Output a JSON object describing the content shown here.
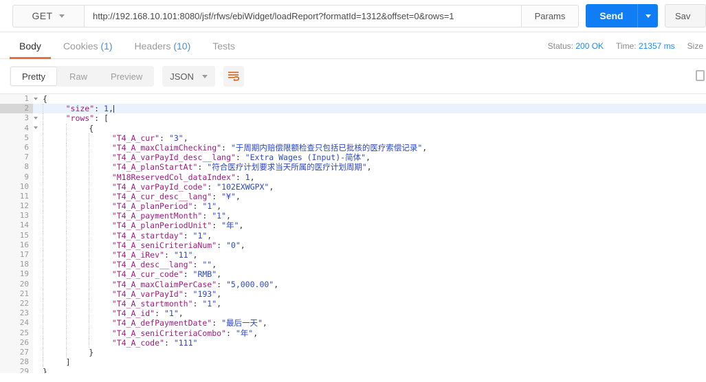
{
  "request": {
    "method": "GET",
    "url": "http://192.168.10.101:8080/jsf/rfws/ebiWidget/loadReport?formatId=1312&offset=0&rows=1",
    "params_label": "Params",
    "send_label": "Send",
    "save_label": "Sav"
  },
  "response": {
    "tabs": [
      {
        "label": "Body",
        "count": "",
        "active": true
      },
      {
        "label": "Cookies",
        "count": "(1)",
        "active": false
      },
      {
        "label": "Headers",
        "count": "(10)",
        "active": false
      },
      {
        "label": "Tests",
        "count": "",
        "active": false
      }
    ],
    "status_label": "Status:",
    "status_value": "200 OK",
    "time_label": "Time:",
    "time_value": "21357 ms",
    "size_label": "Size"
  },
  "format_bar": {
    "modes": [
      {
        "label": "Pretty",
        "active": true
      },
      {
        "label": "Raw",
        "active": false
      },
      {
        "label": "Preview",
        "active": false
      }
    ],
    "language": "JSON",
    "wrap_icon": "word-wrap-icon",
    "copy_icon": "copy-icon"
  },
  "code": {
    "lines": [
      {
        "no": 1,
        "fold": true,
        "indent": 0,
        "segs": [
          {
            "t": "{",
            "c": "p"
          }
        ]
      },
      {
        "no": 2,
        "fold": false,
        "indent": 1,
        "highlight": true,
        "caret": true,
        "segs": [
          {
            "t": "\"size\"",
            "c": "k"
          },
          {
            "t": ": ",
            "c": "p"
          },
          {
            "t": "1",
            "c": "n"
          },
          {
            "t": ",",
            "c": "p"
          }
        ]
      },
      {
        "no": 3,
        "fold": true,
        "indent": 1,
        "segs": [
          {
            "t": "\"rows\"",
            "c": "k"
          },
          {
            "t": ": [",
            "c": "p"
          }
        ]
      },
      {
        "no": 4,
        "fold": true,
        "indent": 2,
        "segs": [
          {
            "t": "{",
            "c": "p"
          }
        ]
      },
      {
        "no": 5,
        "fold": false,
        "indent": 3,
        "segs": [
          {
            "t": "\"T4_A_cur\"",
            "c": "k"
          },
          {
            "t": ": ",
            "c": "p"
          },
          {
            "t": "\"3\"",
            "c": "s"
          },
          {
            "t": ",",
            "c": "p"
          }
        ]
      },
      {
        "no": 6,
        "fold": false,
        "indent": 3,
        "segs": [
          {
            "t": "\"T4_A_maxClaimChecking\"",
            "c": "k"
          },
          {
            "t": ": ",
            "c": "p"
          },
          {
            "t": "\"于周期内赔偿限额检查只包括已批核的医疗索偿记录\"",
            "c": "s"
          },
          {
            "t": ",",
            "c": "p"
          }
        ]
      },
      {
        "no": 7,
        "fold": false,
        "indent": 3,
        "segs": [
          {
            "t": "\"T4_A_varPayId_desc__lang\"",
            "c": "k"
          },
          {
            "t": ": ",
            "c": "p"
          },
          {
            "t": "\"Extra Wages (Input)-简体\"",
            "c": "s"
          },
          {
            "t": ",",
            "c": "p"
          }
        ]
      },
      {
        "no": 8,
        "fold": false,
        "indent": 3,
        "segs": [
          {
            "t": "\"T4_A_planStartAt\"",
            "c": "k"
          },
          {
            "t": ": ",
            "c": "p"
          },
          {
            "t": "\"符合医疗计划要求当天所属的医疗计划周期\"",
            "c": "s"
          },
          {
            "t": ",",
            "c": "p"
          }
        ]
      },
      {
        "no": 9,
        "fold": false,
        "indent": 3,
        "segs": [
          {
            "t": "\"M18ReservedCol_dataIndex\"",
            "c": "k"
          },
          {
            "t": ": ",
            "c": "p"
          },
          {
            "t": "1",
            "c": "n"
          },
          {
            "t": ",",
            "c": "p"
          }
        ]
      },
      {
        "no": 10,
        "fold": false,
        "indent": 3,
        "segs": [
          {
            "t": "\"T4_A_varPayId_code\"",
            "c": "k"
          },
          {
            "t": ": ",
            "c": "p"
          },
          {
            "t": "\"102EXWGPX\"",
            "c": "s"
          },
          {
            "t": ",",
            "c": "p"
          }
        ]
      },
      {
        "no": 11,
        "fold": false,
        "indent": 3,
        "segs": [
          {
            "t": "\"T4_A_cur_desc__lang\"",
            "c": "k"
          },
          {
            "t": ": ",
            "c": "p"
          },
          {
            "t": "\"¥\"",
            "c": "s"
          },
          {
            "t": ",",
            "c": "p"
          }
        ]
      },
      {
        "no": 12,
        "fold": false,
        "indent": 3,
        "segs": [
          {
            "t": "\"T4_A_planPeriod\"",
            "c": "k"
          },
          {
            "t": ": ",
            "c": "p"
          },
          {
            "t": "\"1\"",
            "c": "s"
          },
          {
            "t": ",",
            "c": "p"
          }
        ]
      },
      {
        "no": 13,
        "fold": false,
        "indent": 3,
        "segs": [
          {
            "t": "\"T4_A_paymentMonth\"",
            "c": "k"
          },
          {
            "t": ": ",
            "c": "p"
          },
          {
            "t": "\"1\"",
            "c": "s"
          },
          {
            "t": ",",
            "c": "p"
          }
        ]
      },
      {
        "no": 14,
        "fold": false,
        "indent": 3,
        "segs": [
          {
            "t": "\"T4_A_planPeriodUnit\"",
            "c": "k"
          },
          {
            "t": ": ",
            "c": "p"
          },
          {
            "t": "\"年\"",
            "c": "s"
          },
          {
            "t": ",",
            "c": "p"
          }
        ]
      },
      {
        "no": 15,
        "fold": false,
        "indent": 3,
        "segs": [
          {
            "t": "\"T4_A_startday\"",
            "c": "k"
          },
          {
            "t": ": ",
            "c": "p"
          },
          {
            "t": "\"1\"",
            "c": "s"
          },
          {
            "t": ",",
            "c": "p"
          }
        ]
      },
      {
        "no": 16,
        "fold": false,
        "indent": 3,
        "segs": [
          {
            "t": "\"T4_A_seniCriteriaNum\"",
            "c": "k"
          },
          {
            "t": ": ",
            "c": "p"
          },
          {
            "t": "\"0\"",
            "c": "s"
          },
          {
            "t": ",",
            "c": "p"
          }
        ]
      },
      {
        "no": 17,
        "fold": false,
        "indent": 3,
        "segs": [
          {
            "t": "\"T4_A_iRev\"",
            "c": "k"
          },
          {
            "t": ": ",
            "c": "p"
          },
          {
            "t": "\"11\"",
            "c": "s"
          },
          {
            "t": ",",
            "c": "p"
          }
        ]
      },
      {
        "no": 18,
        "fold": false,
        "indent": 3,
        "segs": [
          {
            "t": "\"T4_A_desc__lang\"",
            "c": "k"
          },
          {
            "t": ": ",
            "c": "p"
          },
          {
            "t": "\"\"",
            "c": "s"
          },
          {
            "t": ",",
            "c": "p"
          }
        ]
      },
      {
        "no": 19,
        "fold": false,
        "indent": 3,
        "segs": [
          {
            "t": "\"T4_A_cur_code\"",
            "c": "k"
          },
          {
            "t": ": ",
            "c": "p"
          },
          {
            "t": "\"RMB\"",
            "c": "s"
          },
          {
            "t": ",",
            "c": "p"
          }
        ]
      },
      {
        "no": 20,
        "fold": false,
        "indent": 3,
        "segs": [
          {
            "t": "\"T4_A_maxClaimPerCase\"",
            "c": "k"
          },
          {
            "t": ": ",
            "c": "p"
          },
          {
            "t": "\"5,000.00\"",
            "c": "s"
          },
          {
            "t": ",",
            "c": "p"
          }
        ]
      },
      {
        "no": 21,
        "fold": false,
        "indent": 3,
        "segs": [
          {
            "t": "\"T4_A_varPayId\"",
            "c": "k"
          },
          {
            "t": ": ",
            "c": "p"
          },
          {
            "t": "\"193\"",
            "c": "s"
          },
          {
            "t": ",",
            "c": "p"
          }
        ]
      },
      {
        "no": 22,
        "fold": false,
        "indent": 3,
        "segs": [
          {
            "t": "\"T4_A_startmonth\"",
            "c": "k"
          },
          {
            "t": ": ",
            "c": "p"
          },
          {
            "t": "\"1\"",
            "c": "s"
          },
          {
            "t": ",",
            "c": "p"
          }
        ]
      },
      {
        "no": 23,
        "fold": false,
        "indent": 3,
        "segs": [
          {
            "t": "\"T4_A_id\"",
            "c": "k"
          },
          {
            "t": ": ",
            "c": "p"
          },
          {
            "t": "\"1\"",
            "c": "s"
          },
          {
            "t": ",",
            "c": "p"
          }
        ]
      },
      {
        "no": 24,
        "fold": false,
        "indent": 3,
        "segs": [
          {
            "t": "\"T4_A_defPaymentDate\"",
            "c": "k"
          },
          {
            "t": ": ",
            "c": "p"
          },
          {
            "t": "\"最后一天\"",
            "c": "s"
          },
          {
            "t": ",",
            "c": "p"
          }
        ]
      },
      {
        "no": 25,
        "fold": false,
        "indent": 3,
        "segs": [
          {
            "t": "\"T4_A_seniCriteriaCombo\"",
            "c": "k"
          },
          {
            "t": ": ",
            "c": "p"
          },
          {
            "t": "\"年\"",
            "c": "s"
          },
          {
            "t": ",",
            "c": "p"
          }
        ]
      },
      {
        "no": 26,
        "fold": false,
        "indent": 3,
        "segs": [
          {
            "t": "\"T4_A_code\"",
            "c": "k"
          },
          {
            "t": ": ",
            "c": "p"
          },
          {
            "t": "\"111\"",
            "c": "s"
          }
        ]
      },
      {
        "no": 27,
        "fold": false,
        "indent": 2,
        "segs": [
          {
            "t": "}",
            "c": "p"
          }
        ]
      },
      {
        "no": 28,
        "fold": false,
        "indent": 1,
        "segs": [
          {
            "t": "]",
            "c": "p"
          }
        ]
      },
      {
        "no": 29,
        "fold": false,
        "indent": 0,
        "segs": [
          {
            "t": "}",
            "c": "p"
          }
        ]
      }
    ]
  }
}
